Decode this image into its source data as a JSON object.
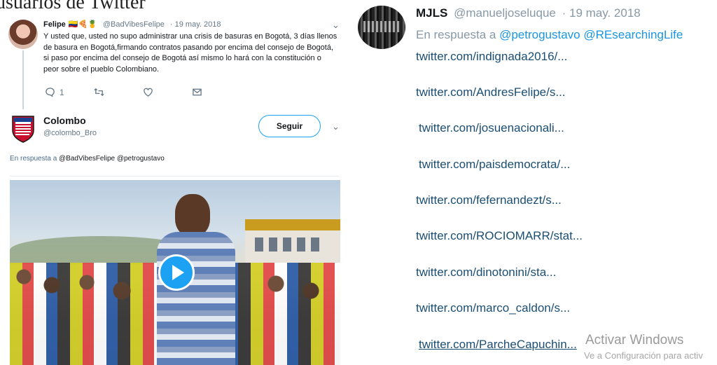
{
  "caption": "usuarios de Twitter",
  "tweet1": {
    "name": "Felipe",
    "emojis": "🇨🇴🍕🍍",
    "handle": "@BadVibesFelipe",
    "date": "· 19 may. 2018",
    "text": "Y usted que, usted no supo administrar una crisis de basuras en Bogotá, 3 días llenos de basura en Bogotá,firmando contratos pasando por encima del consejo de Bogotá, si paso por encima del consejo de Bogotá así mismo lo hará con la constitución o peor sobre el pueblo Colombiano.",
    "actions": {
      "reply_count": "1",
      "retweet_count": "",
      "like_count": ""
    }
  },
  "tweet2": {
    "name": "Colombo",
    "handle": "@colombo_Bro",
    "follow_label": "Seguir",
    "reply_label": "En respuesta a",
    "reply_mentions": "@BadVibesFelipe @petrogustavo"
  },
  "right_tweet": {
    "name": "MJLS",
    "handle": "@manueljoseluque",
    "date": "· 19 may. 2018",
    "reply_label": "En respuesta a",
    "reply_mentions": "@petrogustavo @REsearchingLife",
    "links": [
      "twitter.com/indignada2016/...",
      "twitter.com/AndresFelipe/s...",
      "twitter.com/josuenacionali...",
      "twitter.com/paisdemocrata/...",
      "twitter.com/fefernandezt/s...",
      "twitter.com/ROCIOMARR/stat...",
      "twitter.com/dinotonini/sta...",
      "twitter.com/marco_caldon/s...",
      "twitter.com/ParcheCapuchin..."
    ]
  },
  "watermark": {
    "title": "Activar Windows",
    "subtitle": "Ve a Configuración para activ"
  },
  "colors": {
    "accent": "#1da1f2",
    "link": "#1b4e73",
    "muted": "#8899a6"
  },
  "icons": [
    "reply-icon",
    "retweet-icon",
    "like-icon",
    "message-icon",
    "chevron-down-icon",
    "play-icon"
  ]
}
